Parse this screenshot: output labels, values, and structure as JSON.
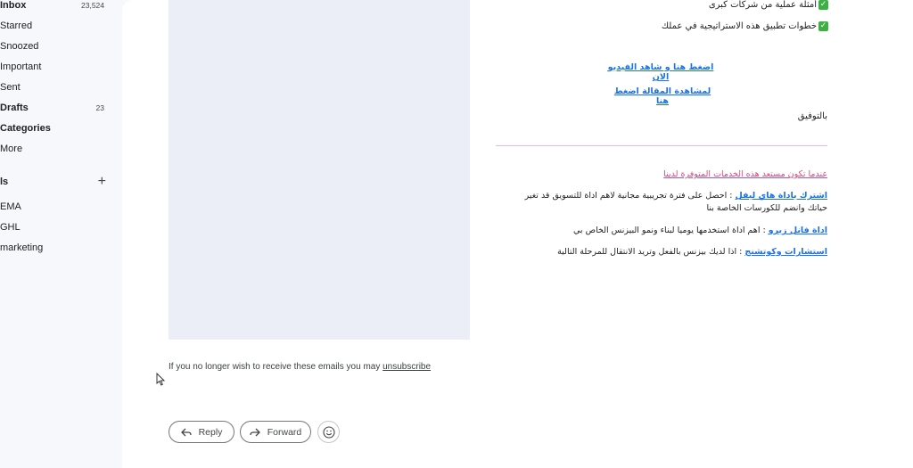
{
  "sidebar": {
    "items": [
      {
        "label": "Inbox",
        "count": "23,524",
        "bold": true
      },
      {
        "label": "Starred",
        "count": ""
      },
      {
        "label": "Snoozed",
        "count": ""
      },
      {
        "label": "Important",
        "count": ""
      },
      {
        "label": "Sent",
        "count": ""
      },
      {
        "label": "Drafts",
        "count": "23",
        "bold": true
      },
      {
        "label": "Categories",
        "count": "",
        "bold": true
      },
      {
        "label": "More",
        "count": ""
      }
    ],
    "labels_heading": "ls",
    "labels": [
      "EMA",
      "GHL",
      "marketing"
    ]
  },
  "email": {
    "check_items": [
      "أمثلة عملية من شركات كبرى",
      "خطوات تطبيق هذه الاستراتيجية في عملك"
    ],
    "video_link": "اضغط هنا و شاهد الفيديو الان",
    "article_link": "لمشاهدة المقالة اضغط هنا",
    "signoff": "بالتوفيق",
    "services_heading": "عندما تكون مستعد هذه الخدمات المتوفرة لدينا",
    "services": [
      {
        "link": "اشترك باداة هاي ليفل",
        "text": " : احصل على فترة تجريبية مجانية لاهم اداة للتسويق قد تغير حياتك وانضم للكورسات الخاصة بنا"
      },
      {
        "link": "اداة فانل زيرو",
        "text": " : اهم اداة استخدمها يوميا لبناء ونمو البيزنس الخاص بي"
      },
      {
        "link": "استشارات وكوتشنج",
        "text": " : اذا لديك بيزنس بالفعل وتريد الانتقال للمرحلة التالية"
      }
    ]
  },
  "footer": {
    "text": "If you no longer wish to receive these emails you may ",
    "unsubscribe": "unsubscribe"
  },
  "actions": {
    "reply": "Reply",
    "forward": "Forward"
  },
  "colors": {
    "link": "#1a73e8",
    "pink": "#e0457b",
    "check": "#3cb043"
  }
}
